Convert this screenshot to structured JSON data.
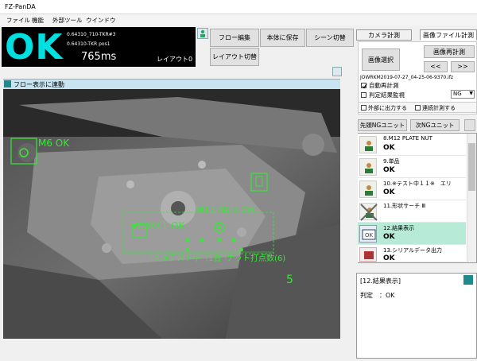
{
  "window_title": "FZ-PanDA",
  "menu": [
    "ファイル",
    "機能",
    "外部ツール",
    "ウインドウ"
  ],
  "result": {
    "judgement": "OK",
    "line1": "0.64310_710-TKR#3",
    "line2": "0.64310-TKR pos1",
    "time": "765ms",
    "layout": "レイアウト0"
  },
  "toolbar": {
    "flow_edit": "フロー編集",
    "save_to_body": "本体に保存",
    "scene_switch": "シーン切替",
    "layout_switch": "レイアウト切替"
  },
  "image_view": {
    "header": "フロー表示に連動",
    "overlay_labels": {
      "m6": "M6 OK",
      "m12": "M12 NUT OK",
      "work": "WORK1 OK",
      "test": "10.※テスト中（1台 ·ナット打点数(6)",
      "count": "5"
    }
  },
  "right_panel": {
    "tabs": [
      "カメラ計測",
      "画像ファイル計測"
    ],
    "image_select": "画像選択",
    "image_remeasure": "画像再計測",
    "prev": "<<",
    "next": ">>",
    "filename": "JOWRKM2019-07-27_04-25-06-9370.ifz",
    "auto_remeasure": "自動再計測",
    "judge_monitor": "判定結果監視",
    "judge_value": "NG",
    "external_output": "外部に出力する",
    "continuous": "連続計測する",
    "first_ng": "先頭NGユニット",
    "next_ng": "次NGユニット"
  },
  "units": [
    {
      "name": "8.M12 PLATE NUT",
      "status": "OK"
    },
    {
      "name": "9.単品",
      "status": "OK"
    },
    {
      "name": "10.※テスト中１１※　エリ",
      "status": "OK"
    },
    {
      "name": "11.形状サーチ Ⅲ",
      "status": ""
    },
    {
      "name": "12.結果表示",
      "status": "OK"
    },
    {
      "name": "13.シリアルデータ出力",
      "status": "OK"
    }
  ],
  "detail": {
    "title": "[12.結果表示]",
    "judge": "判定　：OK"
  },
  "colors": {
    "ok_cyan": "#00e0e0",
    "overlay_green": "#39e639",
    "selected_row": "#b8ead8",
    "header_blue": "#c8e4f0"
  }
}
